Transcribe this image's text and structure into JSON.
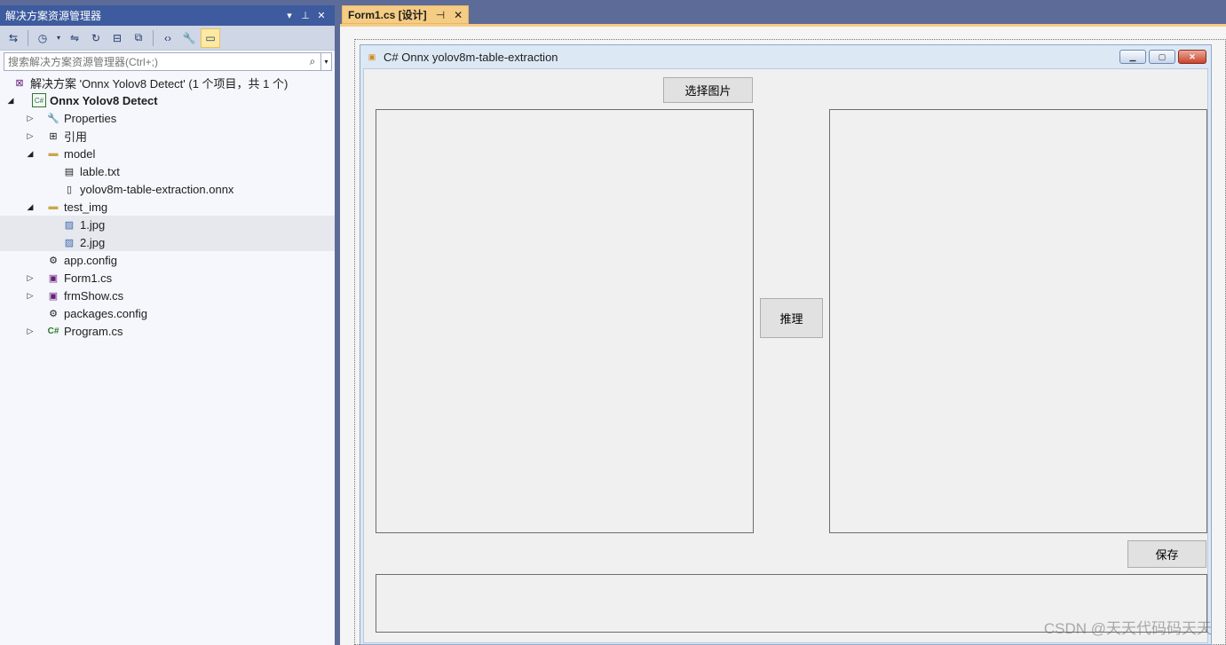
{
  "solution_explorer": {
    "title": "解决方案资源管理器",
    "search_placeholder": "搜索解决方案资源管理器(Ctrl+;)",
    "tree": [
      {
        "label": "解决方案 'Onnx Yolov8 Detect' (1 个项目，共 1 个)",
        "icon": "solution-icon"
      },
      {
        "label": "Onnx Yolov8 Detect",
        "icon": "csharp-project-icon"
      },
      {
        "label": "Properties",
        "icon": "wrench-icon"
      },
      {
        "label": "引用",
        "icon": "references-icon"
      },
      {
        "label": "model",
        "icon": "folder-icon"
      },
      {
        "label": "lable.txt",
        "icon": "text-file-icon"
      },
      {
        "label": "yolov8m-table-extraction.onnx",
        "icon": "file-icon"
      },
      {
        "label": "test_img",
        "icon": "folder-icon"
      },
      {
        "label": "1.jpg",
        "icon": "image-icon"
      },
      {
        "label": "2.jpg",
        "icon": "image-icon"
      },
      {
        "label": "app.config",
        "icon": "config-icon"
      },
      {
        "label": "Form1.cs",
        "icon": "form-icon"
      },
      {
        "label": "frmShow.cs",
        "icon": "form-icon"
      },
      {
        "label": "packages.config",
        "icon": "config-icon"
      },
      {
        "label": "Program.cs",
        "icon": "csharp-file-icon"
      }
    ]
  },
  "document_tab": {
    "label": "Form1.cs [设计]"
  },
  "form": {
    "title": "C# Onnx yolov8m-table-extraction",
    "select_button": "选择图片",
    "infer_button": "推理",
    "save_button": "保存"
  },
  "watermark": "CSDN @天天代码码天天",
  "colors": {
    "sidebar_title": "#3d5b9e",
    "tab_active": "#f5cc84",
    "ide_background": "#5d6b99"
  }
}
